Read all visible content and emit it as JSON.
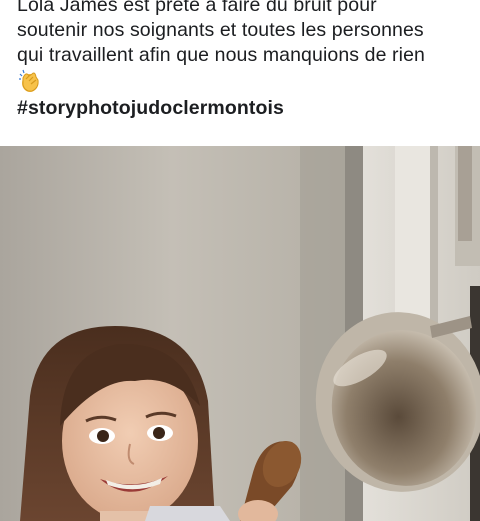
{
  "post": {
    "text_lines": [
      "Lola James est prête à faire du bruit pour",
      "soutenir nos soignants et toutes les personnes",
      "qui travaillent afin que nous manquions de rien"
    ],
    "emoji_icon": "clapping-hands-icon",
    "hashtag": "#storyphotojudoclermontois"
  },
  "photo": {
    "subject": "child-with-pan-and-wooden-spoon-photo"
  },
  "colors": {
    "text": "#1c1e21",
    "background": "#ffffff",
    "wall": "#bfb9ae",
    "door_frame": "#d9d6cf",
    "pan_metal": "#a79a88"
  }
}
